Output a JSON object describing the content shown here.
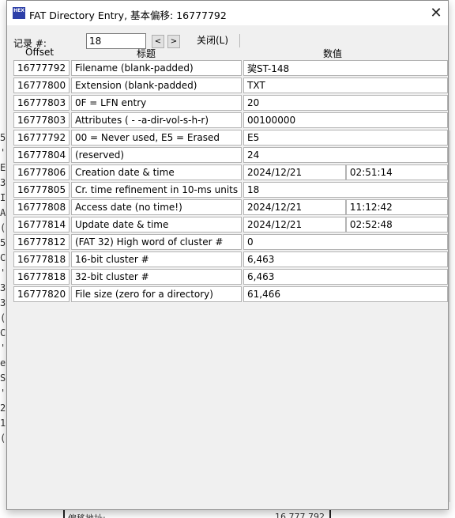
{
  "window": {
    "title": "FAT Directory Entry, 基本偏移: 16777792",
    "icon_name": "hex-app-icon",
    "icon_text": "HEX"
  },
  "record": {
    "label": "记录 #:",
    "value": "18",
    "prev_label": "<",
    "next_label": ">",
    "close_label": "关闭(L)"
  },
  "headers": {
    "offset": "Offset",
    "title": "标题",
    "value": "数值"
  },
  "rows": [
    {
      "offset": "16777792",
      "label": "Filename (blank-padded)",
      "value": "巭ST-148"
    },
    {
      "offset": "16777800",
      "label": "Extension (blank-padded)",
      "value": "TXT"
    },
    {
      "offset": "16777803",
      "label": "0F = LFN entry",
      "value": "20"
    },
    {
      "offset": "16777803",
      "label": "Attributes ( - -a-dir-vol-s-h-r)",
      "value": "00100000"
    },
    {
      "offset": "16777792",
      "label": "00 = Never used, E5 = Erased",
      "value": "E5"
    },
    {
      "offset": "16777804",
      "label": "(reserved)",
      "value": "24"
    },
    {
      "offset": "16777806",
      "label": "Creation date & time",
      "value": "2024/12/21",
      "value2": "02:51:14"
    },
    {
      "offset": "16777805",
      "label": "Cr. time refinement in 10-ms units",
      "value": "18"
    },
    {
      "offset": "16777808",
      "label": "Access date (no time!)",
      "value": "2024/12/21",
      "value2": "11:12:42"
    },
    {
      "offset": "16777814",
      "label": "Update date & time",
      "value": "2024/12/21",
      "value2": "02:52:48"
    },
    {
      "offset": "16777812",
      "label": "(FAT 32) High word of cluster #",
      "value": "0"
    },
    {
      "offset": "16777818",
      "label": "16-bit cluster #",
      "value": "6,463"
    },
    {
      "offset": "16777818",
      "label": "32-bit cluster #",
      "value": "6,463"
    },
    {
      "offset": "16777820",
      "label": "File size (zero for a directory)",
      "value": "61,466"
    }
  ],
  "background": {
    "left_chars": [
      "5",
      "'S",
      "E",
      "3",
      "I",
      "A",
      "(",
      "5",
      "C",
      "'",
      "3",
      "3",
      "(",
      "C",
      "'I",
      "e",
      "S",
      "'",
      "2",
      "1",
      "("
    ],
    "bottom_left": "偏移地址:",
    "bottom_right": "16,777,792"
  }
}
